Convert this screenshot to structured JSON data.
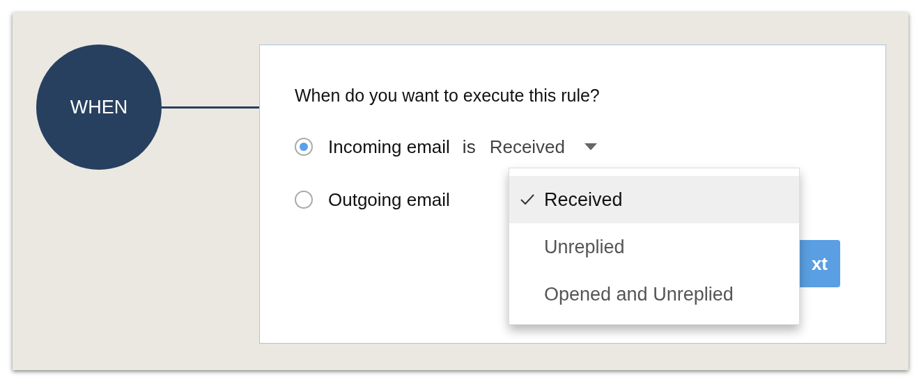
{
  "node": {
    "label": "WHEN"
  },
  "question": "When do you want to execute this rule?",
  "options": [
    {
      "label": "Incoming email",
      "selected": true,
      "condition": {
        "word": "is",
        "value": "Received"
      }
    },
    {
      "label": "Outgoing email",
      "selected": false
    }
  ],
  "dropdown_menu": [
    {
      "label": "Received",
      "selected": true
    },
    {
      "label": "Unreplied",
      "selected": false
    },
    {
      "label": "Opened and Unreplied",
      "selected": false
    }
  ],
  "next_button": {
    "label": "xt"
  }
}
